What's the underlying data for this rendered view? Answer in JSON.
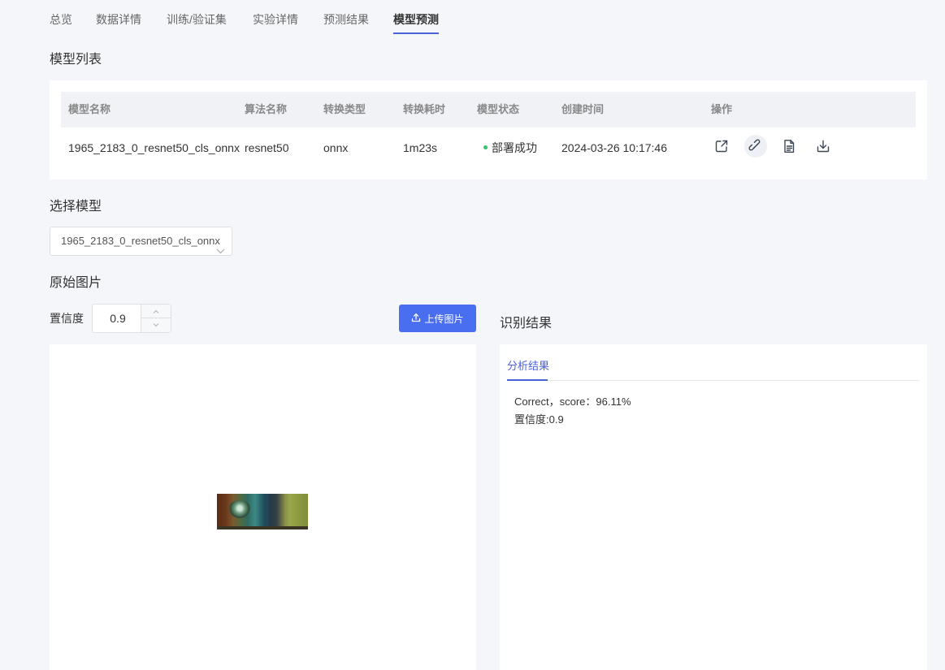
{
  "nav": {
    "tabs": [
      {
        "label": "总览"
      },
      {
        "label": "数据详情"
      },
      {
        "label": "训练/验证集"
      },
      {
        "label": "实验详情"
      },
      {
        "label": "预测结果"
      },
      {
        "label": "模型预测"
      }
    ],
    "active_tab": "模型预测"
  },
  "model_list": {
    "title": "模型列表",
    "columns": [
      "模型名称",
      "算法名称",
      "转换类型",
      "转换耗时",
      "模型状态",
      "创建时间",
      "操作"
    ],
    "rows": [
      {
        "name": "1965_2183_0_resnet50_cls_onnx",
        "algorithm": "resnet50",
        "convert_type": "onnx",
        "convert_time": "1m23s",
        "status": "部署成功",
        "status_color": "#32c56d",
        "created": "2024-03-26 10:17:46",
        "actions": [
          "share-icon",
          "link-icon",
          "document-icon",
          "download-icon"
        ]
      }
    ]
  },
  "select_model": {
    "title": "选择模型",
    "value": "1965_2183_0_resnet50_cls_onnx"
  },
  "original_image": {
    "title": "原始图片",
    "confidence_label": "置信度",
    "confidence_value": "0.9",
    "upload_label": "上传图片"
  },
  "recognition": {
    "title": "识别结果",
    "tab_label": "分析结果",
    "result_line": "Correct，score：96.11%",
    "confidence_line": "置信度:0.9"
  },
  "colors": {
    "accent": "#4a62d8",
    "button": "#4a6ef0",
    "success": "#32c56d"
  }
}
